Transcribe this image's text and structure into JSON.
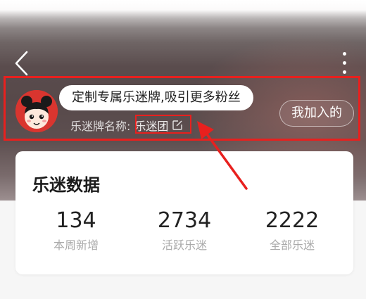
{
  "header": {
    "back_icon": "chevron-left-icon",
    "more_icon": "vertical-dots-icon"
  },
  "profile": {
    "tooltip_text": "定制专属乐迷牌,吸引更多粉丝",
    "fan_badge_label": "乐迷牌名称:",
    "fan_badge_name": "乐迷团",
    "edit_icon": "edit-icon",
    "join_button_label": "我加入的"
  },
  "colors": {
    "highlight": "#e8201e",
    "avatar_bg": "#d9352f"
  },
  "stats_card": {
    "title": "乐迷数据",
    "items": [
      {
        "value": "134",
        "label": "本周新增"
      },
      {
        "value": "2734",
        "label": "活跃乐迷"
      },
      {
        "value": "2222",
        "label": "全部乐迷"
      }
    ]
  }
}
